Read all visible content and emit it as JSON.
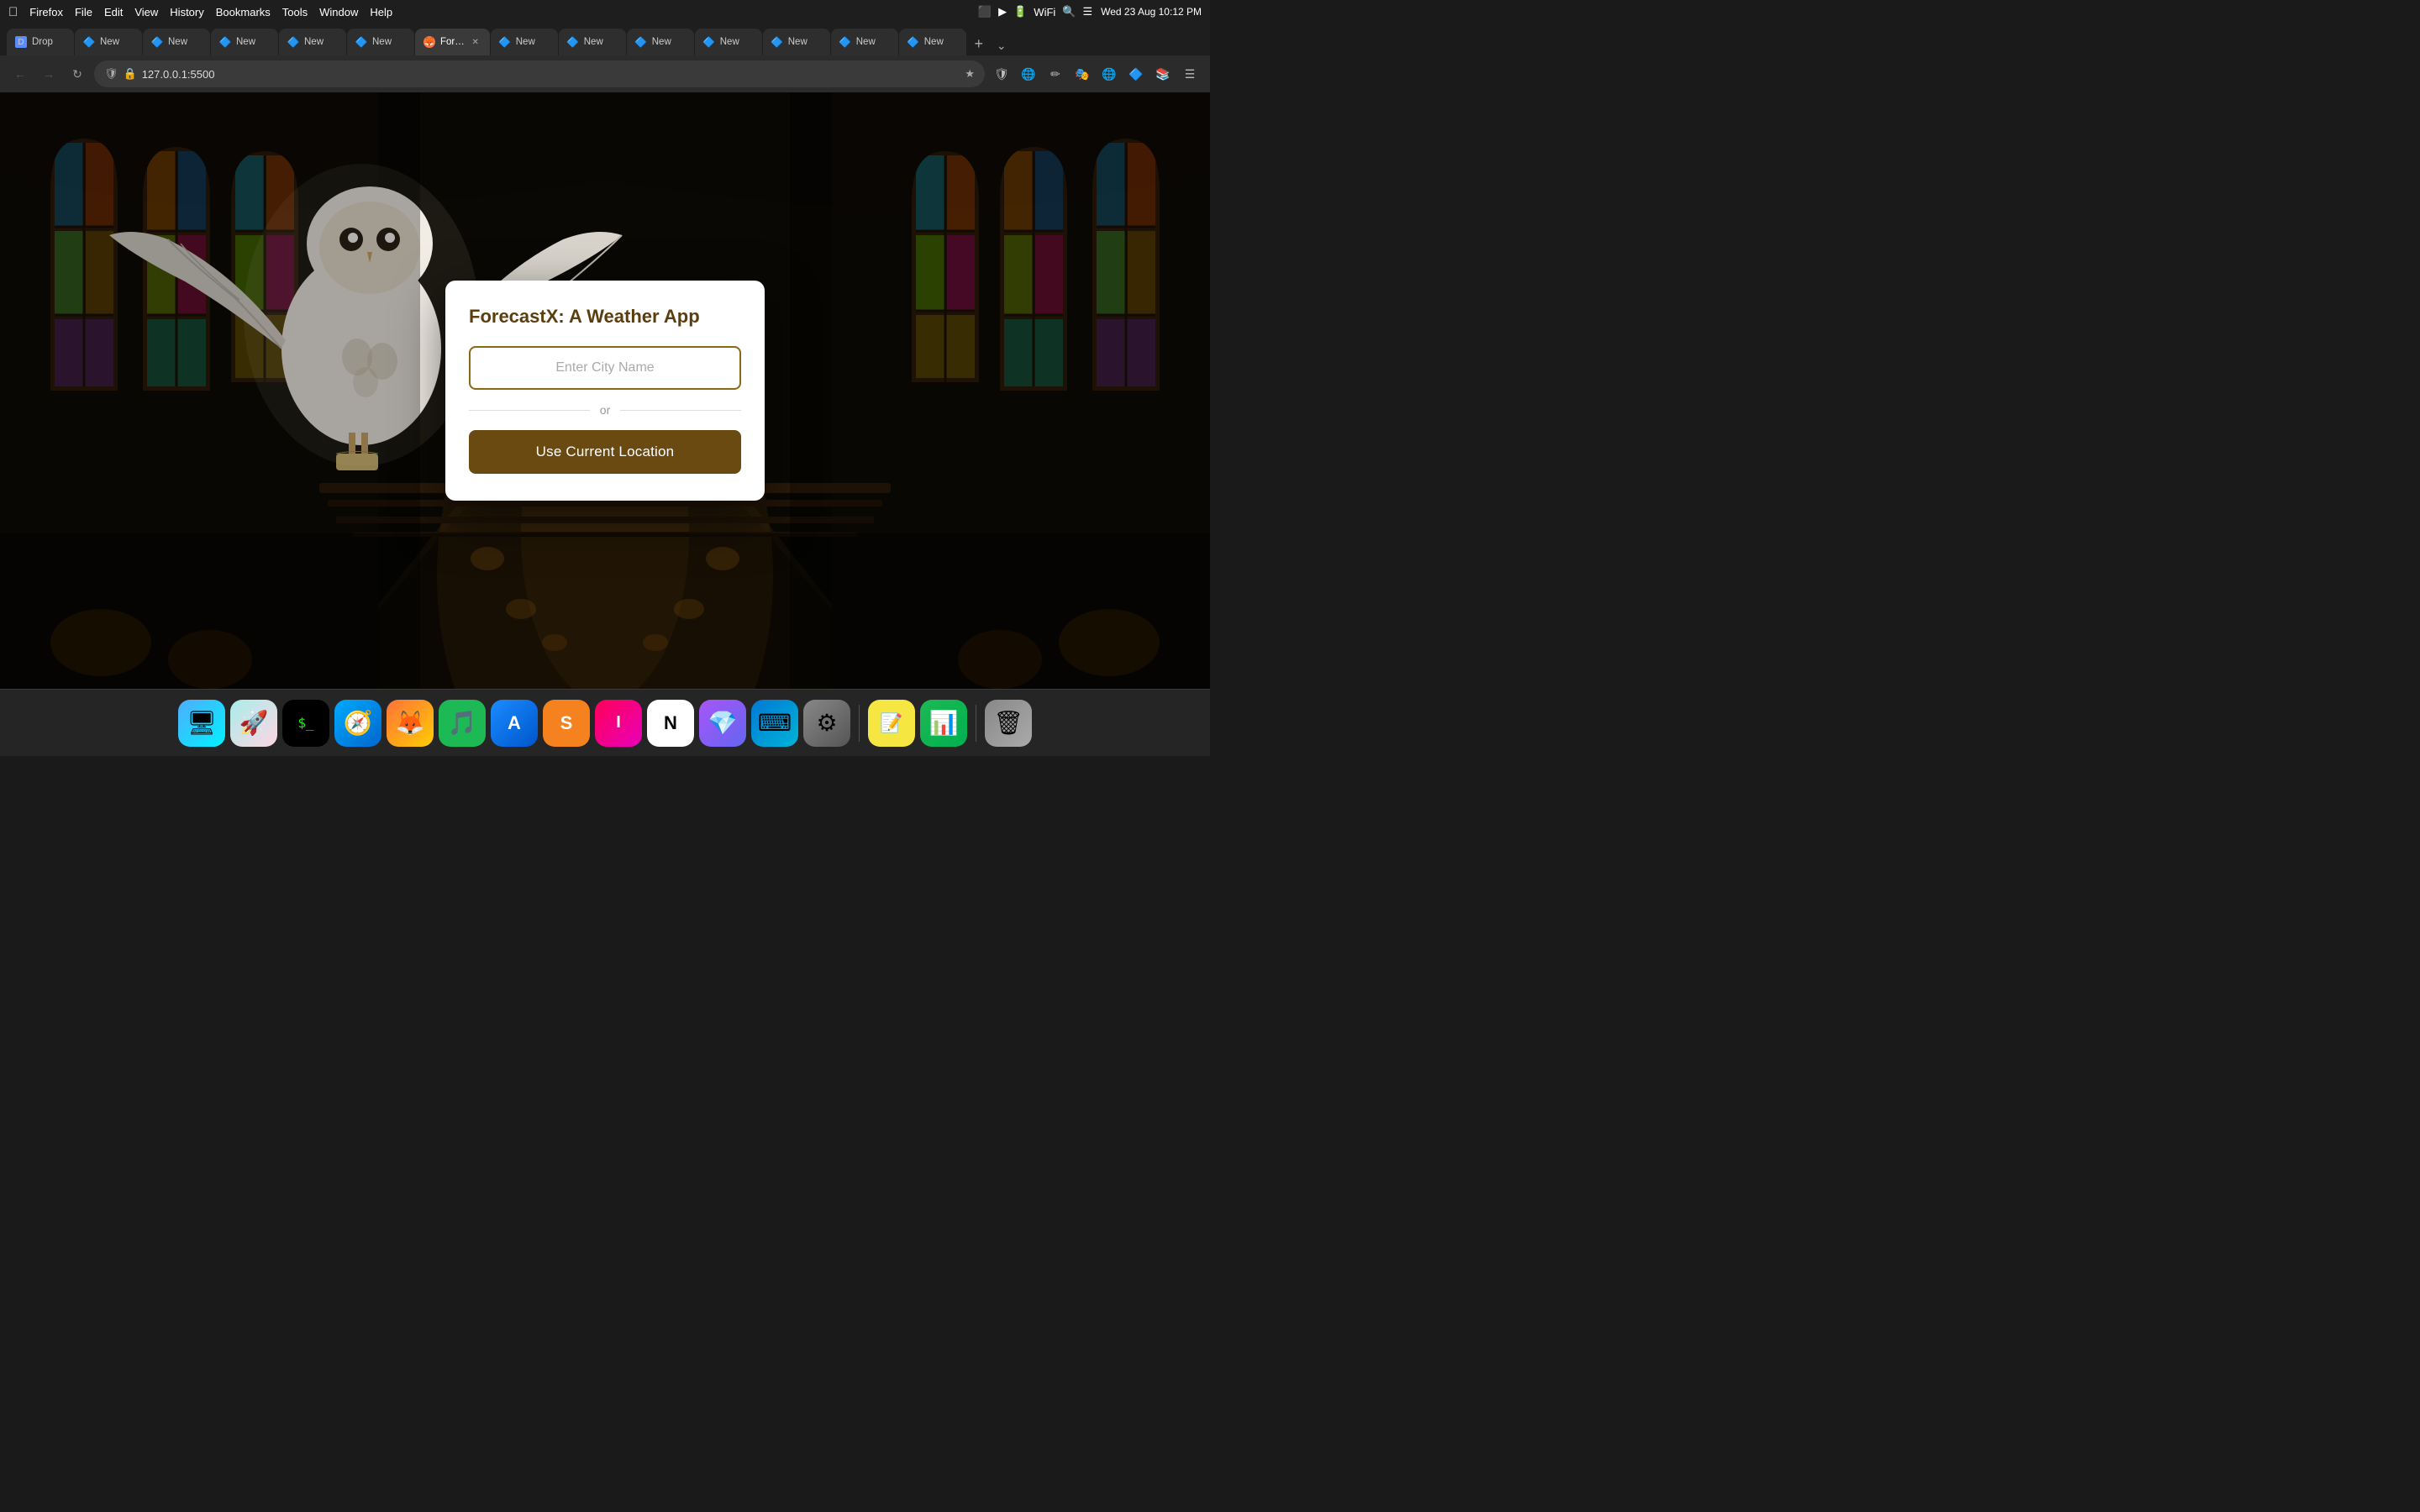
{
  "menubar": {
    "app_name": "Firefox",
    "menus": [
      "File",
      "Edit",
      "View",
      "History",
      "Bookmarks",
      "Tools",
      "Window",
      "Help"
    ],
    "clock": "Wed 23 Aug  10:12 PM"
  },
  "tabs": [
    {
      "id": "drop",
      "label": "Drop",
      "favicon_type": "drop",
      "active": false
    },
    {
      "id": "new1",
      "label": "New",
      "favicon_type": "new-tab",
      "active": false
    },
    {
      "id": "new2",
      "label": "New",
      "favicon_type": "new-tab",
      "active": false
    },
    {
      "id": "new3",
      "label": "New",
      "favicon_type": "new-tab",
      "active": false
    },
    {
      "id": "new4",
      "label": "New",
      "favicon_type": "new-tab",
      "active": false
    },
    {
      "id": "new5",
      "label": "New",
      "favicon_type": "new-tab",
      "active": false
    },
    {
      "id": "forecast",
      "label": "For…",
      "favicon_type": "fox",
      "active": true
    },
    {
      "id": "new6",
      "label": "New",
      "favicon_type": "new-tab",
      "active": false
    },
    {
      "id": "new7",
      "label": "New",
      "favicon_type": "new-tab",
      "active": false
    },
    {
      "id": "new8",
      "label": "New",
      "favicon_type": "new-tab",
      "active": false
    },
    {
      "id": "new9",
      "label": "New",
      "favicon_type": "new-tab",
      "active": false
    },
    {
      "id": "new10",
      "label": "New",
      "favicon_type": "new-tab",
      "active": false
    },
    {
      "id": "new11",
      "label": "New",
      "favicon_type": "new-tab",
      "active": false
    },
    {
      "id": "new12",
      "label": "New",
      "favicon_type": "new-tab",
      "active": false
    }
  ],
  "address_bar": {
    "url": "127.0.0.1:5500",
    "protocol": "127.0.0.1:",
    "port_path": "5500"
  },
  "card": {
    "title": "ForecastX: A Weather App",
    "city_input_placeholder": "Enter City Name",
    "or_text": "or",
    "location_button_label": "Use Current Location"
  },
  "dock": {
    "items": [
      {
        "id": "finder",
        "label": "Finder",
        "css_class": "finder",
        "icon": "🖥"
      },
      {
        "id": "launchpad",
        "label": "Launchpad",
        "css_class": "launchpad",
        "icon": "🚀"
      },
      {
        "id": "terminal",
        "label": "Terminal",
        "css_class": "terminal",
        "icon": "$"
      },
      {
        "id": "safari",
        "label": "Safari",
        "css_class": "safari",
        "icon": "🧭"
      },
      {
        "id": "firefox",
        "label": "Firefox",
        "css_class": "firefox",
        "icon": "🦊"
      },
      {
        "id": "spotify",
        "label": "Spotify",
        "css_class": "spotify",
        "icon": "🎵"
      },
      {
        "id": "appstore",
        "label": "App Store",
        "css_class": "appstore",
        "icon": "A"
      },
      {
        "id": "sublime",
        "label": "Sublime Text",
        "css_class": "sublime",
        "icon": "S"
      },
      {
        "id": "intellij",
        "label": "IntelliJ IDEA",
        "css_class": "intellij",
        "icon": "I"
      },
      {
        "id": "notion",
        "label": "Notion",
        "css_class": "notion",
        "icon": "N"
      },
      {
        "id": "crystal",
        "label": "Crystal",
        "css_class": "crystal",
        "icon": "💎"
      },
      {
        "id": "vscode",
        "label": "VS Code",
        "css_class": "vscode",
        "icon": "⌨"
      },
      {
        "id": "sysprefs",
        "label": "System Preferences",
        "css_class": "sysprefs",
        "icon": "⚙"
      },
      {
        "id": "stickies",
        "label": "Stickies",
        "css_class": "stickies",
        "icon": "📝"
      },
      {
        "id": "numbers",
        "label": "Numbers",
        "css_class": "numbers",
        "icon": "📊"
      },
      {
        "id": "trash",
        "label": "Trash",
        "css_class": "trash",
        "icon": "🗑"
      }
    ]
  }
}
